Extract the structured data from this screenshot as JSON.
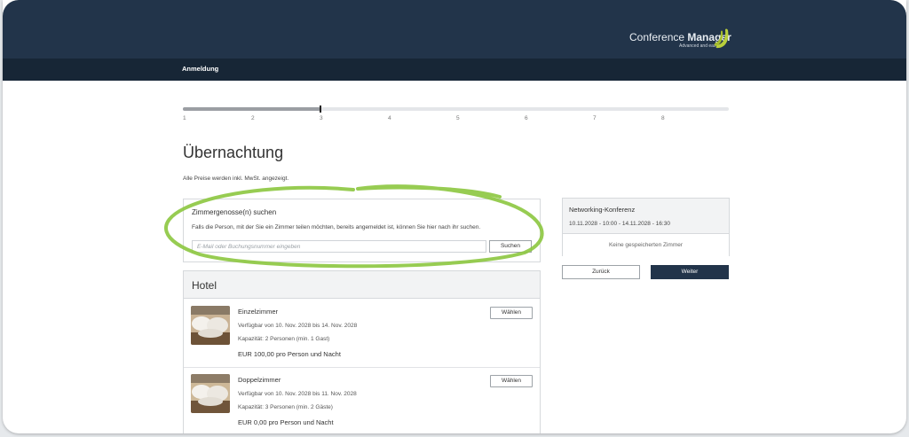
{
  "header": {
    "logo_text_regular": "Conference",
    "logo_text_bold": "Manager",
    "logo_tagline": "Advanced and easy",
    "logo_icon": "banana-logo-icon",
    "colors": {
      "header_bg": "#22344a",
      "nav_bg": "#172636",
      "logo_accent": "#b9cf3b"
    }
  },
  "nav": {
    "item": "Anmeldung"
  },
  "progress": {
    "steps": [
      "1",
      "2",
      "3",
      "4",
      "5",
      "6",
      "7",
      "8"
    ],
    "current_step": 3
  },
  "page": {
    "title": "Übernachtung",
    "vat_note": "Alle Preise werden inkl. MwSt. angezeigt."
  },
  "roommate": {
    "title": "Zimmergenosse(n) suchen",
    "description": "Falls die Person, mit der Sie ein Zimmer teilen möchten, bereits angemeldet ist, können Sie hier nach ihr suchen.",
    "input_value": "",
    "input_placeholder": "E-Mail oder Buchungsnummer eingeben",
    "search_label": "Suchen"
  },
  "hotel": {
    "title": "Hotel",
    "rooms": [
      {
        "name": "Einzelzimmer",
        "availability": "Verfügbar von 10. Nov. 2028 bis 14. Nov. 2028",
        "capacity": "Kapazität: 2 Personen (min. 1 Gast)",
        "price": "EUR 100,00 pro Person und Nacht",
        "button": "Wählen"
      },
      {
        "name": "Doppelzimmer",
        "availability": "Verfügbar von 10. Nov. 2028 bis 11. Nov. 2028",
        "capacity": "Kapazität: 3 Personen (min. 2 Gäste)",
        "price": "EUR 0,00 pro Person und Nacht",
        "button": "Wählen"
      }
    ]
  },
  "summary": {
    "title": "Networking-Konferenz",
    "dates": "10.11.2028 - 10:00 - 14.11.2028 - 16:30",
    "empty_text": "Keine gespeicherten Zimmer"
  },
  "actions": {
    "back": "Zurück",
    "next": "Weiter"
  },
  "annotation": {
    "highlight_color": "#8cc63f"
  }
}
